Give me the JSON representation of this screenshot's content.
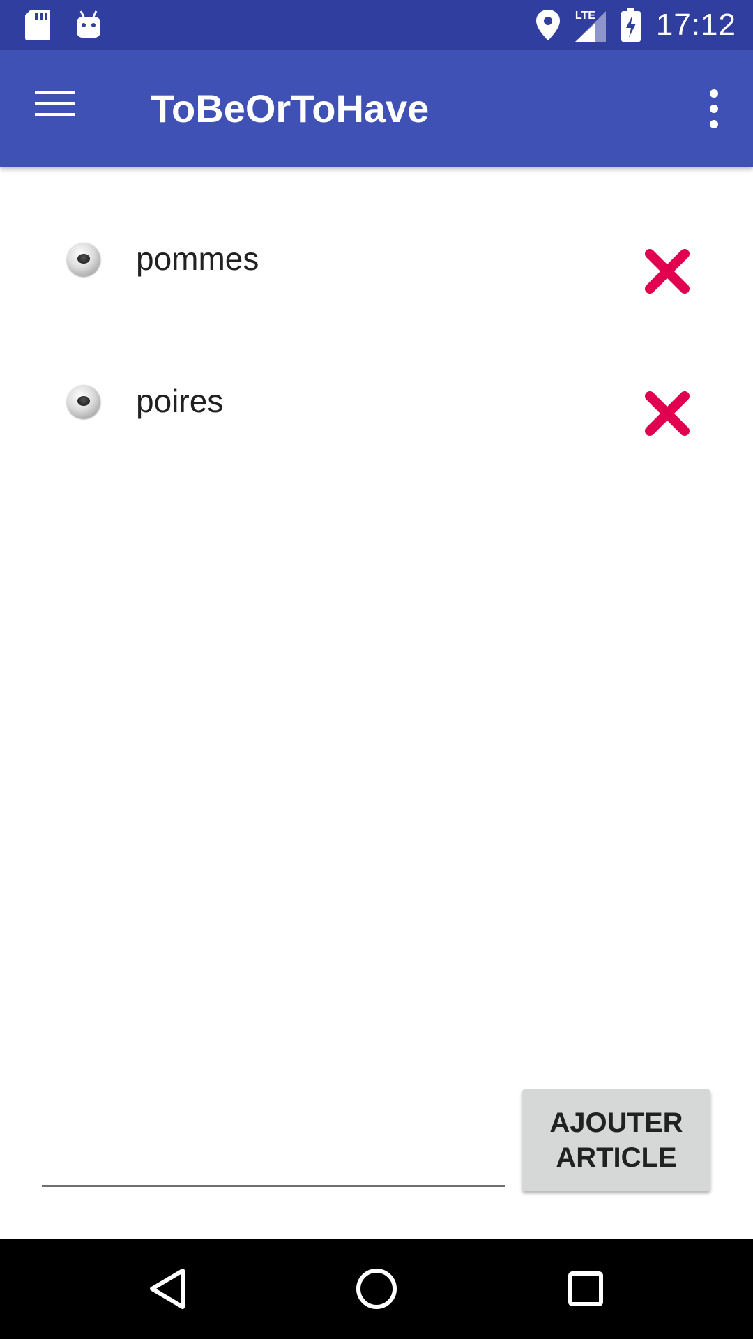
{
  "status_bar": {
    "time": "17:12",
    "network": "LTE",
    "icons": [
      "sd-card-icon",
      "android-icon",
      "location-icon",
      "signal-icon",
      "battery-charging-icon"
    ]
  },
  "app_bar": {
    "title": "ToBeOrToHave",
    "menu_icon": "hamburger-menu-icon",
    "overflow_icon": "more-vert-icon"
  },
  "list": {
    "items": [
      {
        "label": "pommes",
        "selected": false
      },
      {
        "label": "poires",
        "selected": false
      }
    ],
    "delete_icon": "close-icon"
  },
  "add_form": {
    "input_value": "",
    "input_placeholder": "",
    "button_line1": "AJOUTER",
    "button_line2": "ARTICLE"
  },
  "colors": {
    "status_bar": "#303F9F",
    "app_bar": "#3F51B5",
    "delete": "#E0004F",
    "button": "#D6D7D7"
  },
  "nav_bar": {
    "icons": [
      "back-icon",
      "home-icon",
      "recents-icon"
    ]
  }
}
